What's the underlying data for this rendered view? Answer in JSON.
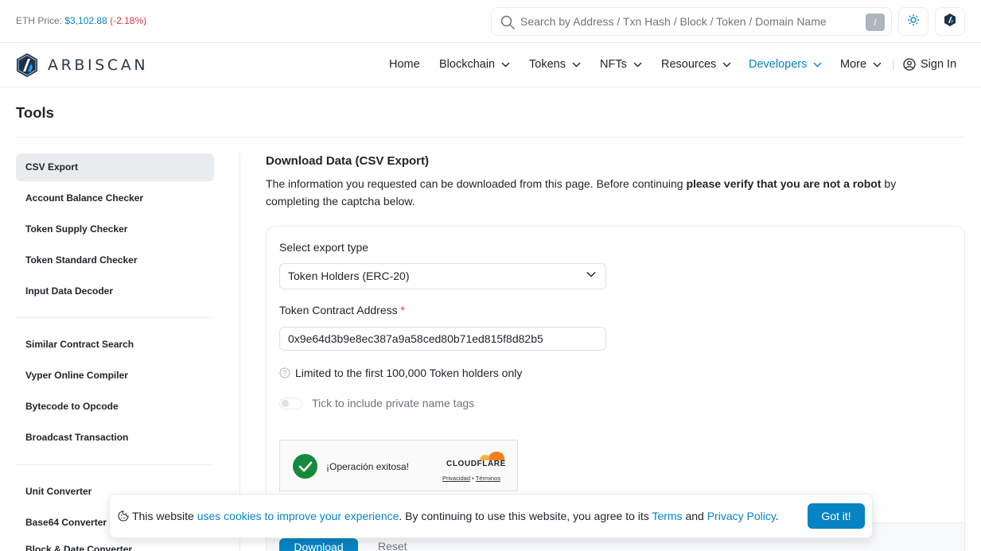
{
  "topbar": {
    "eth_label": "ETH Price:",
    "eth_value": "$3,102.88",
    "eth_change": "(-2.18%)",
    "search_placeholder": "Search by Address / Txn Hash / Block / Token / Domain Name",
    "slash_key": "/",
    "theme_icon": "sun-icon",
    "network_icon": "arbitrum-logo-icon"
  },
  "brand": {
    "name": "ARBISCAN"
  },
  "nav": {
    "items": [
      {
        "label": "Home"
      },
      {
        "label": "Blockchain"
      },
      {
        "label": "Tokens"
      },
      {
        "label": "NFTs"
      },
      {
        "label": "Resources"
      },
      {
        "label": "Developers"
      },
      {
        "label": "More"
      }
    ],
    "separator": "|",
    "signin": "Sign In"
  },
  "page": {
    "title": "Tools"
  },
  "sidebar": {
    "group1": [
      "CSV Export",
      "Account Balance Checker",
      "Token Supply Checker",
      "Token Standard Checker",
      "Input Data Decoder"
    ],
    "group2": [
      "Similar Contract Search",
      "Vyper Online Compiler",
      "Bytecode to Opcode",
      "Broadcast Transaction"
    ],
    "group3": [
      "Unit Converter",
      "Base64 Converter",
      "Block & Date Converter"
    ]
  },
  "main": {
    "heading": "Download Data (CSV Export)",
    "desc_pre": "The information you requested can be downloaded from this page. Before continuing ",
    "desc_bold": "please verify that you are not a robot",
    "desc_post": " by completing the captcha below.",
    "export_label": "Select export type",
    "export_value": "Token Holders (ERC-20)",
    "contract_label": "Token Contract Address",
    "required_mark": "*",
    "contract_value": "0x9e64d3b9e8ec387a9a58ced80b71ed815f8d82b5",
    "limit_note": "Limited to the first 100,000 Token holders only",
    "toggle_label": "Tick to include private name tags",
    "captcha": {
      "status": "¡Operación exitosa!",
      "brand": "CLOUDFLARE",
      "privacy": "Privacidad",
      "dot": "•",
      "terms": "Términos"
    },
    "download_button": "Download",
    "reset_button": "Reset"
  },
  "cookie": {
    "text1": "This website ",
    "link1": "uses cookies to improve your experience",
    "text2": ". By continuing to use this website, you agree to its ",
    "link2": "Terms",
    "text3": " and ",
    "link3": "Privacy Policy",
    "text4": ".",
    "button": "Got it!"
  },
  "colors": {
    "accent": "#0784c3",
    "negative": "#dc3545",
    "success": "#148a3a",
    "cloudflare": "#f38020"
  }
}
